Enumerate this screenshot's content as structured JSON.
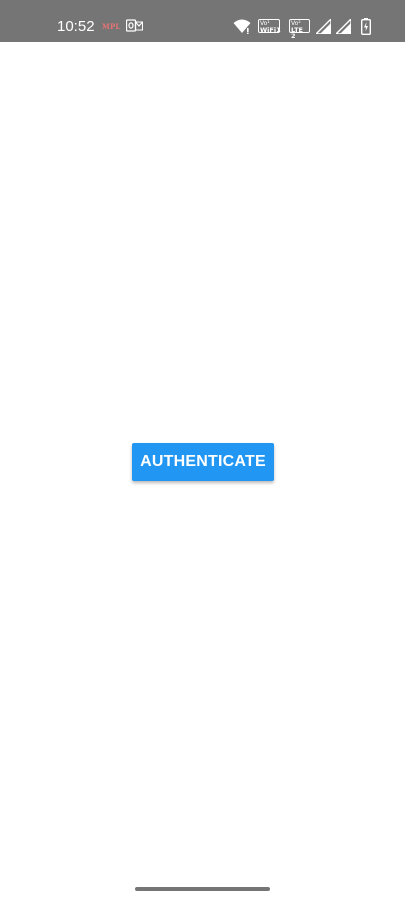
{
  "status_bar": {
    "time": "10:52",
    "notifications": {
      "mpl_label": "MPL",
      "mpl_color": "#e57373",
      "outlook_icon": "outlook-icon"
    },
    "wifi_icon": "wifi-icon",
    "badges": {
      "wifi_calling": {
        "line1": "Vo¹",
        "line2": "WiFi1"
      },
      "volte": {
        "line1": "Vo²",
        "line2": "LTE 2"
      }
    },
    "signal_icons": [
      "signal-sim1-icon",
      "signal-sim2-icon"
    ],
    "battery_icon": "battery-charging-icon",
    "background_color": "#757575"
  },
  "main": {
    "authenticate_button": {
      "label": "AUTHENTICATE",
      "color": "#2196f3"
    }
  },
  "nav": {
    "gesture_handle": "home-gesture-bar"
  }
}
